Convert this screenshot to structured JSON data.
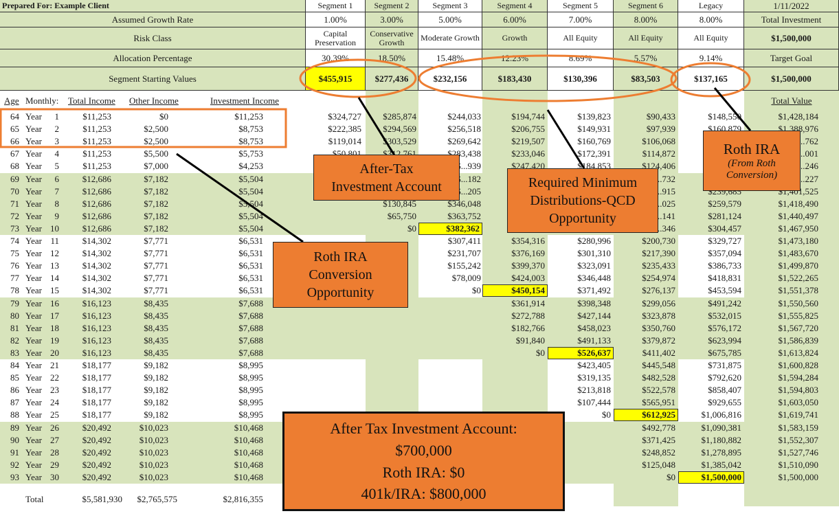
{
  "header": {
    "prepared_for": "Prepared For: Example Client",
    "date": "1/11/2022",
    "row_labels": {
      "growth": "Assumed Growth Rate",
      "risk": "Risk Class",
      "allocation": "Allocation Percentage",
      "starting": "Segment Starting Values"
    },
    "total_investment_label": "Total Investment",
    "total_investment": "$1,500,000",
    "target_goal_label": "Target Goal",
    "target_goal": "$1,500,000",
    "total_value_label": "Total Value",
    "segments": [
      {
        "name": "Segment 1",
        "growth": "1.00%",
        "risk": "Capital Preservation",
        "allocation": "30.39%",
        "start": "$455,915"
      },
      {
        "name": "Segment 2",
        "growth": "3.00%",
        "risk": "Conservative Growth",
        "allocation": "18.50%",
        "start": "$277,436"
      },
      {
        "name": "Segment 3",
        "growth": "5.00%",
        "risk": "Moderate Growth",
        "allocation": "15.48%",
        "start": "$232,156"
      },
      {
        "name": "Segment 4",
        "growth": "6.00%",
        "risk": "Growth",
        "allocation": "12.23%",
        "start": "$183,430"
      },
      {
        "name": "Segment 5",
        "growth": "7.00%",
        "risk": "All Equity",
        "allocation": "8.69%",
        "start": "$130,396"
      },
      {
        "name": "Segment 6",
        "growth": "8.00%",
        "risk": "All Equity",
        "allocation": "5.57%",
        "start": "$83,503"
      },
      {
        "name": "Legacy",
        "growth": "8.00%",
        "risk": "All Equity",
        "allocation": "9.14%",
        "start": "$137,165"
      }
    ]
  },
  "columns": {
    "age": "Age",
    "monthly": "Monthly:",
    "total_income": "Total Income",
    "other_income": "Other Income",
    "investment_income": "Investment Income"
  },
  "rows": [
    {
      "age": "64",
      "year": "Year",
      "n": "1",
      "total": "$11,253",
      "other": "$0",
      "invest": "$11,253",
      "s1": "$324,727",
      "s2": "$285,874",
      "s3": "$244,033",
      "s4": "$194,744",
      "s5": "$139,823",
      "s6": "$90,433",
      "legacy": "$148,550",
      "value": "$1,428,184"
    },
    {
      "age": "65",
      "year": "Year",
      "n": "2",
      "total": "$11,253",
      "other": "$2,500",
      "invest": "$8,753",
      "s1": "$222,385",
      "s2": "$294,569",
      "s3": "$256,518",
      "s4": "$206,755",
      "s5": "$149,931",
      "s6": "$97,939",
      "legacy": "$160,879",
      "value": "$1,388,976"
    },
    {
      "age": "66",
      "year": "Year",
      "n": "3",
      "total": "$11,253",
      "other": "$2,500",
      "invest": "$8,753",
      "s1": "$119,014",
      "s2": "$303,529",
      "s3": "$269,642",
      "s4": "$219,507",
      "s5": "$160,769",
      "s6": "$106,068",
      "legacy": "",
      "value": "$1,...762"
    },
    {
      "age": "67",
      "year": "Year",
      "n": "4",
      "total": "$11,253",
      "other": "$5,500",
      "invest": "$5,753",
      "s1": "$50,801",
      "s2": "$312,761",
      "s3": "$283,438",
      "s4": "$233,046",
      "s5": "$172,391",
      "s6": "$114,872",
      "legacy": "",
      "value": "$1,...001"
    },
    {
      "age": "68",
      "year": "Year",
      "n": "5",
      "total": "$11,253",
      "other": "$7,000",
      "invest": "$4,253",
      "s1": "",
      "s2": "",
      "s3": "$...939",
      "s4": "$247,420",
      "s5": "$184,853",
      "s6": "$124,406",
      "legacy": "",
      "value": "$1,...246"
    },
    {
      "age": "69",
      "year": "Year",
      "n": "6",
      "total": "$12,686",
      "other": "$7,182",
      "invest": "$5,504",
      "s1": "",
      "s2": "",
      "s3": "$...182",
      "s4": "",
      "s5": "",
      "s6": "$...732",
      "legacy": "",
      "value": "$1,...227"
    },
    {
      "age": "70",
      "year": "Year",
      "n": "7",
      "total": "$12,686",
      "other": "$7,182",
      "invest": "$5,504",
      "s1": "",
      "s2": "",
      "s3": "$...205",
      "s4": "",
      "s5": "",
      "s6": "$...915",
      "legacy": "$239,685",
      "value": "$1,401,525"
    },
    {
      "age": "71",
      "year": "Year",
      "n": "8",
      "total": "$12,686",
      "other": "$7,182",
      "invest": "$5,504",
      "s1": "",
      "s2": "$130,845",
      "s3": "$346,048",
      "s4": "",
      "s5": "",
      "s6": "$...025",
      "legacy": "$259,579",
      "value": "$1,418,490"
    },
    {
      "age": "72",
      "year": "Year",
      "n": "9",
      "total": "$12,686",
      "other": "$7,182",
      "invest": "$5,504",
      "s1": "",
      "s2": "$65,750",
      "s3": "$363,752",
      "s4": "",
      "s5": "",
      "s6": "$...141",
      "legacy": "$281,124",
      "value": "$1,440,497"
    },
    {
      "age": "73",
      "year": "Year",
      "n": "10",
      "total": "$12,686",
      "other": "$7,182",
      "invest": "$5,504",
      "s1": "",
      "s2": "$0",
      "s3": "$382,362",
      "s4": "",
      "s5": "",
      "s6": "$...346",
      "legacy": "$304,457",
      "value": "$1,467,950"
    },
    {
      "age": "74",
      "year": "Year",
      "n": "11",
      "total": "$14,302",
      "other": "$7,771",
      "invest": "$6,531",
      "s1": "",
      "s2": "",
      "s3": "$307,411",
      "s4": "$354,316",
      "s5": "$280,996",
      "s6": "$200,730",
      "legacy": "$329,727",
      "value": "$1,473,180"
    },
    {
      "age": "75",
      "year": "Year",
      "n": "12",
      "total": "$14,302",
      "other": "$7,771",
      "invest": "$6,531",
      "s1": "",
      "s2": "",
      "s3": "$231,707",
      "s4": "$376,169",
      "s5": "$301,310",
      "s6": "$217,390",
      "legacy": "$357,094",
      "value": "$1,483,670"
    },
    {
      "age": "76",
      "year": "Year",
      "n": "13",
      "total": "$14,302",
      "other": "$7,771",
      "invest": "$6,531",
      "s1": "",
      "s2": "",
      "s3": "$155,242",
      "s4": "$399,370",
      "s5": "$323,091",
      "s6": "$235,433",
      "legacy": "$386,733",
      "value": "$1,499,870"
    },
    {
      "age": "77",
      "year": "Year",
      "n": "14",
      "total": "$14,302",
      "other": "$7,771",
      "invest": "$6,531",
      "s1": "",
      "s2": "",
      "s3": "$78,009",
      "s4": "$424,003",
      "s5": "$346,448",
      "s6": "$254,974",
      "legacy": "$418,831",
      "value": "$1,522,265"
    },
    {
      "age": "78",
      "year": "Year",
      "n": "15",
      "total": "$14,302",
      "other": "$7,771",
      "invest": "$6,531",
      "s1": "",
      "s2": "",
      "s3": "$0",
      "s4": "$450,154",
      "s5": "$371,492",
      "s6": "$276,137",
      "legacy": "$453,594",
      "value": "$1,551,378"
    },
    {
      "age": "79",
      "year": "Year",
      "n": "16",
      "total": "$16,123",
      "other": "$8,435",
      "invest": "$7,688",
      "s1": "",
      "s2": "",
      "s3": "",
      "s4": "$361,914",
      "s5": "$398,348",
      "s6": "$299,056",
      "legacy": "$491,242",
      "value": "$1,550,560"
    },
    {
      "age": "80",
      "year": "Year",
      "n": "17",
      "total": "$16,123",
      "other": "$8,435",
      "invest": "$7,688",
      "s1": "",
      "s2": "",
      "s3": "",
      "s4": "$272,788",
      "s5": "$427,144",
      "s6": "$323,878",
      "legacy": "$532,015",
      "value": "$1,555,825"
    },
    {
      "age": "81",
      "year": "Year",
      "n": "18",
      "total": "$16,123",
      "other": "$8,435",
      "invest": "$7,688",
      "s1": "",
      "s2": "",
      "s3": "",
      "s4": "$182,766",
      "s5": "$458,023",
      "s6": "$350,760",
      "legacy": "$576,172",
      "value": "$1,567,720"
    },
    {
      "age": "82",
      "year": "Year",
      "n": "19",
      "total": "$16,123",
      "other": "$8,435",
      "invest": "$7,688",
      "s1": "",
      "s2": "",
      "s3": "",
      "s4": "$91,840",
      "s5": "$491,133",
      "s6": "$379,872",
      "legacy": "$623,994",
      "value": "$1,586,839"
    },
    {
      "age": "83",
      "year": "Year",
      "n": "20",
      "total": "$16,123",
      "other": "$8,435",
      "invest": "$7,688",
      "s1": "",
      "s2": "",
      "s3": "",
      "s4": "$0",
      "s5": "$526,637",
      "s6": "$411,402",
      "legacy": "$675,785",
      "value": "$1,613,824"
    },
    {
      "age": "84",
      "year": "Year",
      "n": "21",
      "total": "$18,177",
      "other": "$9,182",
      "invest": "$8,995",
      "s1": "",
      "s2": "",
      "s3": "",
      "s4": "",
      "s5": "$423,405",
      "s6": "$445,548",
      "legacy": "$731,875",
      "value": "$1,600,828"
    },
    {
      "age": "85",
      "year": "Year",
      "n": "22",
      "total": "$18,177",
      "other": "$9,182",
      "invest": "$8,995",
      "s1": "",
      "s2": "",
      "s3": "",
      "s4": "",
      "s5": "$319,135",
      "s6": "$482,528",
      "legacy": "$792,620",
      "value": "$1,594,284"
    },
    {
      "age": "86",
      "year": "Year",
      "n": "23",
      "total": "$18,177",
      "other": "$9,182",
      "invest": "$8,995",
      "s1": "",
      "s2": "",
      "s3": "",
      "s4": "",
      "s5": "$213,818",
      "s6": "$522,578",
      "legacy": "$858,407",
      "value": "$1,594,803"
    },
    {
      "age": "87",
      "year": "Year",
      "n": "24",
      "total": "$18,177",
      "other": "$9,182",
      "invest": "$8,995",
      "s1": "",
      "s2": "",
      "s3": "",
      "s4": "",
      "s5": "$107,444",
      "s6": "$565,951",
      "legacy": "$929,655",
      "value": "$1,603,050"
    },
    {
      "age": "88",
      "year": "Year",
      "n": "25",
      "total": "$18,177",
      "other": "$9,182",
      "invest": "$8,995",
      "s1": "",
      "s2": "",
      "s3": "",
      "s4": "",
      "s5": "$0",
      "s6": "$612,925",
      "legacy": "$1,006,816",
      "value": "$1,619,741"
    },
    {
      "age": "89",
      "year": "Year",
      "n": "26",
      "total": "$20,492",
      "other": "$10,023",
      "invest": "$10,468",
      "s1": "",
      "s2": "",
      "s3": "",
      "s4": "",
      "s5": "",
      "s6": "$492,778",
      "legacy": "$1,090,381",
      "value": "$1,583,159"
    },
    {
      "age": "90",
      "year": "Year",
      "n": "27",
      "total": "$20,492",
      "other": "$10,023",
      "invest": "$10,468",
      "s1": "",
      "s2": "",
      "s3": "",
      "s4": "",
      "s5": "",
      "s6": "$371,425",
      "legacy": "$1,180,882",
      "value": "$1,552,307"
    },
    {
      "age": "91",
      "year": "Year",
      "n": "28",
      "total": "$20,492",
      "other": "$10,023",
      "invest": "$10,468",
      "s1": "",
      "s2": "",
      "s3": "",
      "s4": "",
      "s5": "",
      "s6": "$248,852",
      "legacy": "$1,278,895",
      "value": "$1,527,746"
    },
    {
      "age": "92",
      "year": "Year",
      "n": "29",
      "total": "$20,492",
      "other": "$10,023",
      "invest": "$10,468",
      "s1": "",
      "s2": "",
      "s3": "",
      "s4": "",
      "s5": "",
      "s6": "$125,048",
      "legacy": "$1,385,042",
      "value": "$1,510,090"
    },
    {
      "age": "93",
      "year": "Year",
      "n": "30",
      "total": "$20,492",
      "other": "$10,023",
      "invest": "$10,468",
      "s1": "",
      "s2": "",
      "s3": "",
      "s4": "",
      "s5": "",
      "s6": "$0",
      "legacy": "$1,500,000",
      "value": "$1,500,000"
    }
  ],
  "highlights": {
    "s2": 9,
    "s3": 14,
    "s4": 19,
    "s5": 24,
    "s6": 24,
    "legacy": 29
  },
  "highlights_list": [
    {
      "col": "s3",
      "row": 9
    },
    {
      "col": "s4",
      "row": 14
    },
    {
      "col": "s5",
      "row": 19
    },
    {
      "col": "s6",
      "row": 24
    },
    {
      "col": "legacy",
      "row": 29
    }
  ],
  "totals": {
    "label": "Total",
    "total": "$5,581,930",
    "other": "$2,765,575",
    "invest": "$2,816,355"
  },
  "callouts": {
    "after_tax": [
      "After-Tax",
      "Investment Account"
    ],
    "rmd": [
      "Required Minimum",
      "Distributions-QCD",
      "Opportunity"
    ],
    "roth": {
      "title": "Roth IRA",
      "sub": [
        "(From Roth",
        "Conversion)"
      ]
    },
    "roth_conv": [
      "Roth IRA",
      "Conversion",
      "Opportunity"
    ],
    "summary": [
      "After Tax Investment Account:",
      "$700,000",
      "Roth IRA: $0",
      "401k/IRA: $800,000"
    ]
  },
  "colors": {
    "green": "#d8e4bc",
    "orange": "#ed7d31",
    "highlight": "#ffff00"
  }
}
